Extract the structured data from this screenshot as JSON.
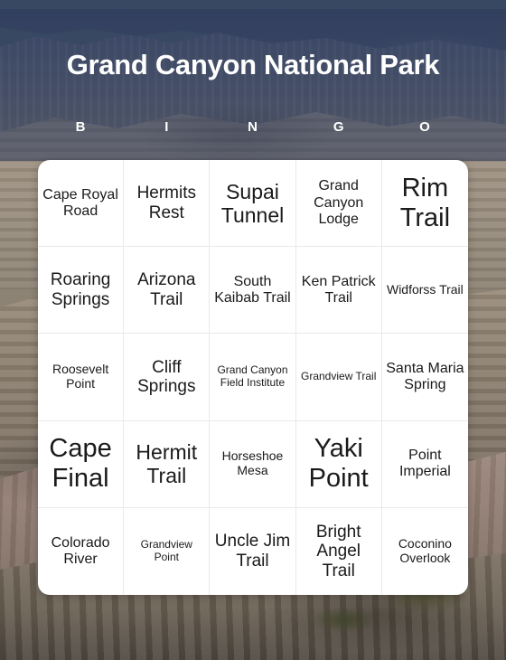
{
  "header": {
    "title": "Grand Canyon National Park",
    "bingo_letters": [
      "B",
      "I",
      "N",
      "G",
      "O"
    ],
    "title_color": "#ffffff",
    "overlay_color": "#203056"
  },
  "card": {
    "background_color": "#ffffff",
    "grid_line_color": "#e9e9ea",
    "text_color": "#1a1a1a",
    "rows": [
      [
        {
          "label": "Cape Royal Road",
          "size": "m"
        },
        {
          "label": "Hermits Rest",
          "size": "l"
        },
        {
          "label": "Supai Tunnel",
          "size": "xl"
        },
        {
          "label": "Grand Canyon Lodge",
          "size": "m"
        },
        {
          "label": "Rim Trail",
          "size": "xxl"
        }
      ],
      [
        {
          "label": "Roaring Springs",
          "size": "l"
        },
        {
          "label": "Arizona Trail",
          "size": "l"
        },
        {
          "label": "South Kaibab Trail",
          "size": "m"
        },
        {
          "label": "Ken Patrick Trail",
          "size": "m"
        },
        {
          "label": "Widforss Trail",
          "size": "s"
        }
      ],
      [
        {
          "label": "Roosevelt Point",
          "size": "s"
        },
        {
          "label": "Cliff Springs",
          "size": "l"
        },
        {
          "label": "Grand Canyon Field Institute",
          "size": "xs"
        },
        {
          "label": "Grandview Trail",
          "size": "xs"
        },
        {
          "label": "Santa Maria Spring",
          "size": "m"
        }
      ],
      [
        {
          "label": "Cape Final",
          "size": "xxl"
        },
        {
          "label": "Hermit Trail",
          "size": "xl"
        },
        {
          "label": "Horseshoe Mesa",
          "size": "s"
        },
        {
          "label": "Yaki Point",
          "size": "xxl"
        },
        {
          "label": "Point Imperial",
          "size": "m"
        }
      ],
      [
        {
          "label": "Colorado River",
          "size": "m"
        },
        {
          "label": "Grandview Point",
          "size": "xs"
        },
        {
          "label": "Uncle Jim Trail",
          "size": "l"
        },
        {
          "label": "Bright Angel Trail",
          "size": "l"
        },
        {
          "label": "Coconino Overlook",
          "size": "s"
        }
      ]
    ]
  }
}
